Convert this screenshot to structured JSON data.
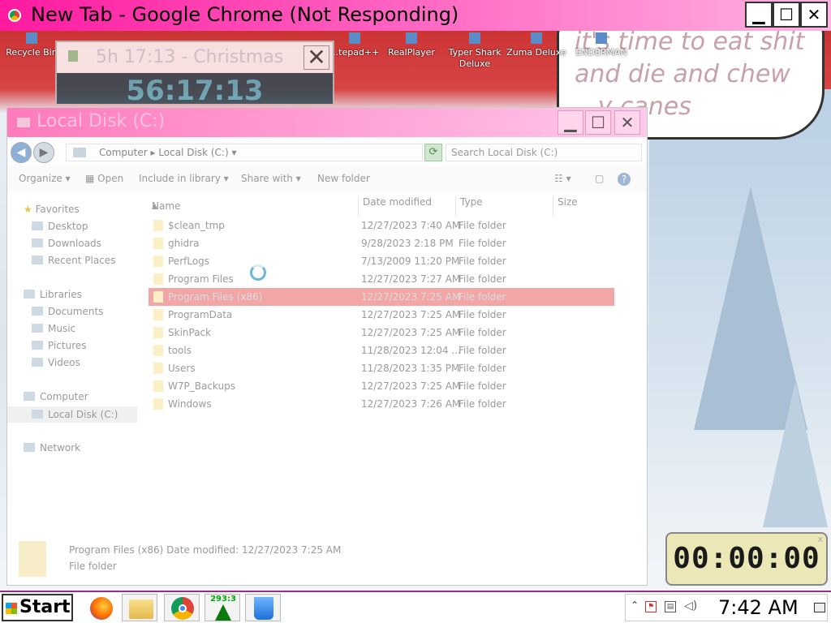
{
  "chrome": {
    "title": "New Tab - Google Chrome (Not Responding)",
    "min": "▁",
    "max": "☐",
    "close": "✕"
  },
  "bubble": {
    "text": "it's time to eat shit and die and chew ...y canes"
  },
  "desktop_icons": [
    {
      "label": "Recycle Bin"
    },
    {
      "label": "...tepad++"
    },
    {
      "label": "RealPlayer"
    },
    {
      "label": "Typer Shark Deluxe"
    },
    {
      "label": "Zuma Deluxe"
    },
    {
      "label": "ENDERMAN"
    }
  ],
  "clock_window": {
    "title": "5h 17:13 - Christmas",
    "face": "56:17:13",
    "close": "✕"
  },
  "explorer": {
    "title": "Local Disk (C:)",
    "address": [
      "Computer",
      "Local Disk (C:)"
    ],
    "search_placeholder": "Search Local Disk (C:)",
    "commands": [
      "Organize",
      "Open",
      "Include in library",
      "Share with",
      "New folder"
    ],
    "nav": {
      "favorites": "Favorites",
      "fav_items": [
        "Desktop",
        "Downloads",
        "Recent Places"
      ],
      "libraries": "Libraries",
      "lib_items": [
        "Documents",
        "Music",
        "Pictures",
        "Videos"
      ],
      "computer": "Computer",
      "comp_items": [
        "Local Disk (C:)"
      ],
      "network": "Network"
    },
    "columns": [
      "Name",
      "Date modified",
      "Type",
      "Size"
    ],
    "rows": [
      {
        "name": "$clean_tmp",
        "date": "12/27/2023 7:40 AM",
        "type": "File folder"
      },
      {
        "name": "ghidra",
        "date": "9/28/2023 2:18 PM",
        "type": "File folder"
      },
      {
        "name": "PerfLogs",
        "date": "7/13/2009 11:20 PM",
        "type": "File folder"
      },
      {
        "name": "Program Files",
        "date": "12/27/2023 7:27 AM",
        "type": "File folder"
      },
      {
        "name": "Program Files (x86)",
        "date": "12/27/2023 7:25 AM",
        "type": "File folder"
      },
      {
        "name": "ProgramData",
        "date": "12/27/2023 7:25 AM",
        "type": "File folder"
      },
      {
        "name": "SkinPack",
        "date": "12/27/2023 7:25 AM",
        "type": "File folder"
      },
      {
        "name": "tools",
        "date": "11/28/2023 12:04 ...",
        "type": "File folder"
      },
      {
        "name": "Users",
        "date": "11/28/2023 1:35 PM",
        "type": "File folder"
      },
      {
        "name": "W7P_Backups",
        "date": "12/27/2023 7:25 AM",
        "type": "File folder"
      },
      {
        "name": "Windows",
        "date": "12/27/2023 7:26 AM",
        "type": "File folder"
      }
    ],
    "details": {
      "name": "Program Files (x86)  Date modified: 12/27/2023 7:25 AM",
      "type": "File folder"
    }
  },
  "timer": {
    "value": "00:00:00",
    "close": "x"
  },
  "taskbar": {
    "start": "Start",
    "tree_count": "293:3",
    "time": "7:42 AM"
  }
}
